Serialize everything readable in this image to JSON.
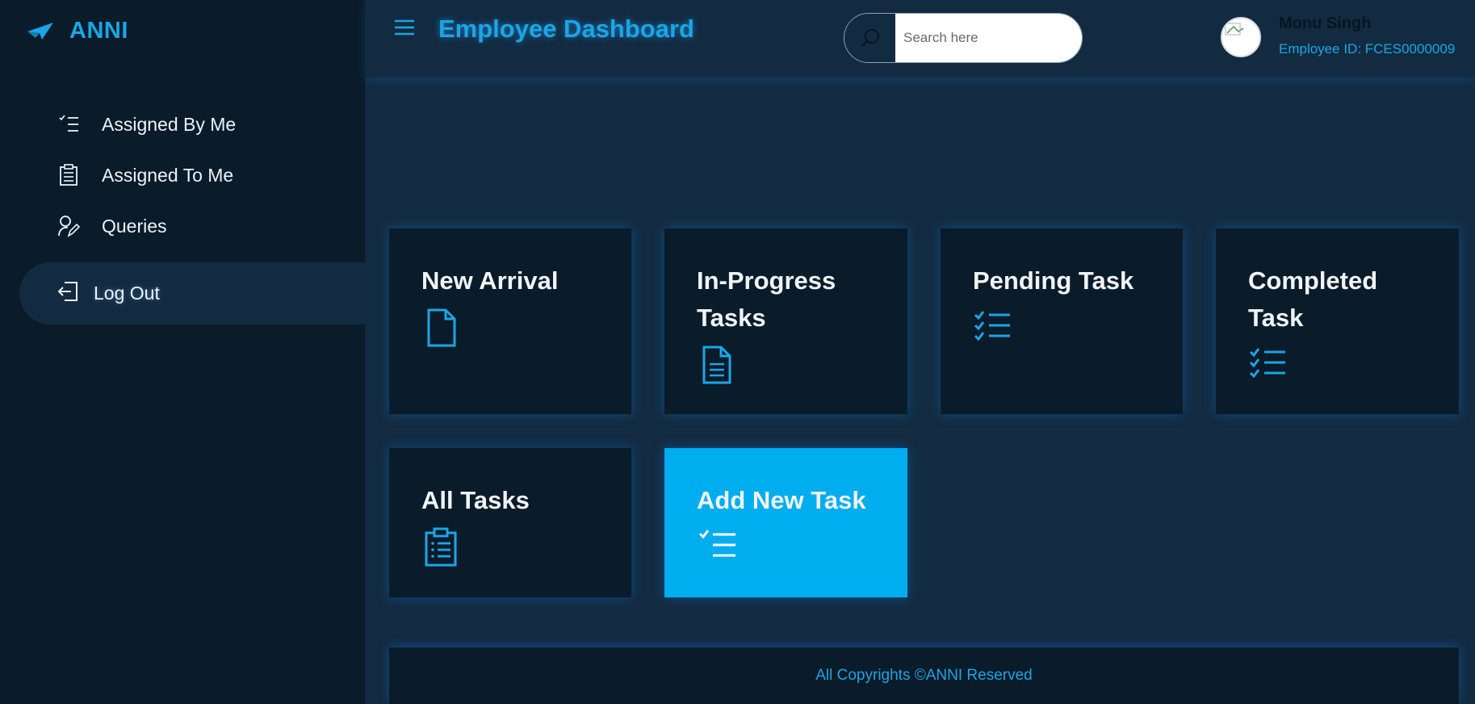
{
  "brand": {
    "name": "ANNI"
  },
  "sidebar": {
    "items": [
      {
        "label": "Assigned By Me",
        "icon": "checklist-icon"
      },
      {
        "label": "Assigned To Me",
        "icon": "clipboard-icon"
      },
      {
        "label": "Queries",
        "icon": "user-edit-icon"
      }
    ],
    "logout_label": "Log Out"
  },
  "header": {
    "title": "Employee Dashboard",
    "search_placeholder": "Search here",
    "user_name": "Monu Singh",
    "user_id": "Employee ID: FCES0000009"
  },
  "cards": [
    {
      "title": "New Arrival",
      "icon": "file-icon"
    },
    {
      "title": "In-Progress Tasks",
      "icon": "file-text-icon"
    },
    {
      "title": "Pending Task",
      "icon": "checklist-icon"
    },
    {
      "title": "Completed Task",
      "icon": "checklist-icon"
    },
    {
      "title": "All Tasks",
      "icon": "clipboard-list-icon"
    },
    {
      "title": "Add New Task",
      "icon": "checklist-icon"
    }
  ],
  "footer": {
    "text": "All Copyrights ©ANNI Reserved"
  },
  "colors": {
    "accent": "#1aa6e6",
    "active_card": "#00adef",
    "panel": "#0a1b2a",
    "background": "#132b41"
  }
}
